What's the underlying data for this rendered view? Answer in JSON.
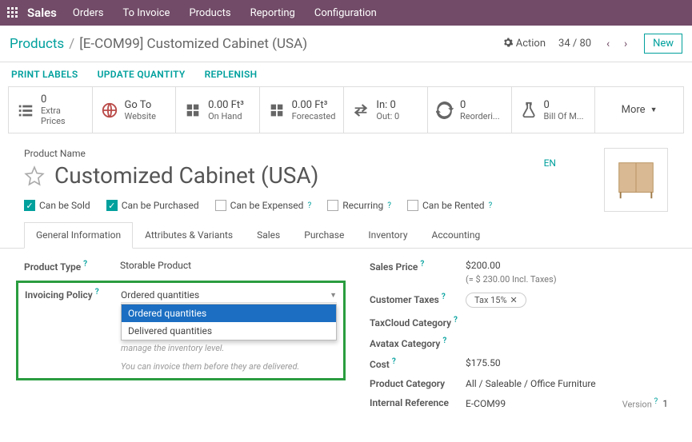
{
  "topbar": {
    "app": "Sales",
    "menu": [
      "Orders",
      "To Invoice",
      "Products",
      "Reporting",
      "Configuration"
    ]
  },
  "breadcrumb": {
    "parent": "Products",
    "current": "[E-COM99] Customized Cabinet (USA)",
    "action": "Action",
    "pager": "34 / 80",
    "new": "New"
  },
  "sub_actions": [
    "PRINT LABELS",
    "UPDATE QUANTITY",
    "REPLENISH"
  ],
  "stats": [
    {
      "n": "0",
      "l": "Extra Prices"
    },
    {
      "n": "Go To",
      "l": "Website"
    },
    {
      "n": "0.00 Ft³",
      "l": "On Hand"
    },
    {
      "n": "0.00 Ft³",
      "l": "Forecasted"
    },
    {
      "n": "In:  0",
      "l": "Out:  0"
    },
    {
      "n": "0",
      "l": "Reorderi..."
    },
    {
      "n": "0",
      "l": "Bill Of M..."
    }
  ],
  "more": "More",
  "product_name_label": "Product Name",
  "product_name": "Customized Cabinet (USA)",
  "lang": "EN",
  "checks": [
    {
      "label": "Can be Sold",
      "on": true,
      "help": false
    },
    {
      "label": "Can be Purchased",
      "on": true,
      "help": false
    },
    {
      "label": "Can be Expensed",
      "on": false,
      "help": true
    },
    {
      "label": "Recurring",
      "on": false,
      "help": true
    },
    {
      "label": "Can be Rented",
      "on": false,
      "help": true
    }
  ],
  "tabs": [
    "General Information",
    "Attributes & Variants",
    "Sales",
    "Purchase",
    "Inventory",
    "Accounting"
  ],
  "left": {
    "product_type_l": "Product Type",
    "product_type": "Storable Product",
    "inv_policy_l": "Invoicing Policy",
    "inv_policy_value": "Ordered quantities",
    "inv_policy_options": [
      "Ordered quantities",
      "Delivered quantities"
    ],
    "hint1": "manage the inventory level.",
    "hint2": "You can invoice them before they are delivered."
  },
  "right": {
    "sales_price_l": "Sales Price",
    "sales_price": "$200.00",
    "incl": "(= $ 230.00 Incl. Taxes)",
    "cust_tax_l": "Customer Taxes",
    "cust_tax": "Tax 15%",
    "taxcloud_l": "TaxCloud Category",
    "avatax_l": "Avatax Category",
    "cost_l": "Cost",
    "cost": "$175.50",
    "pcat_l": "Product Category",
    "pcat": "All / Saleable / Office Furniture",
    "iref_l": "Internal Reference",
    "iref": "E-COM99",
    "version_l": "Version",
    "version": "1"
  }
}
